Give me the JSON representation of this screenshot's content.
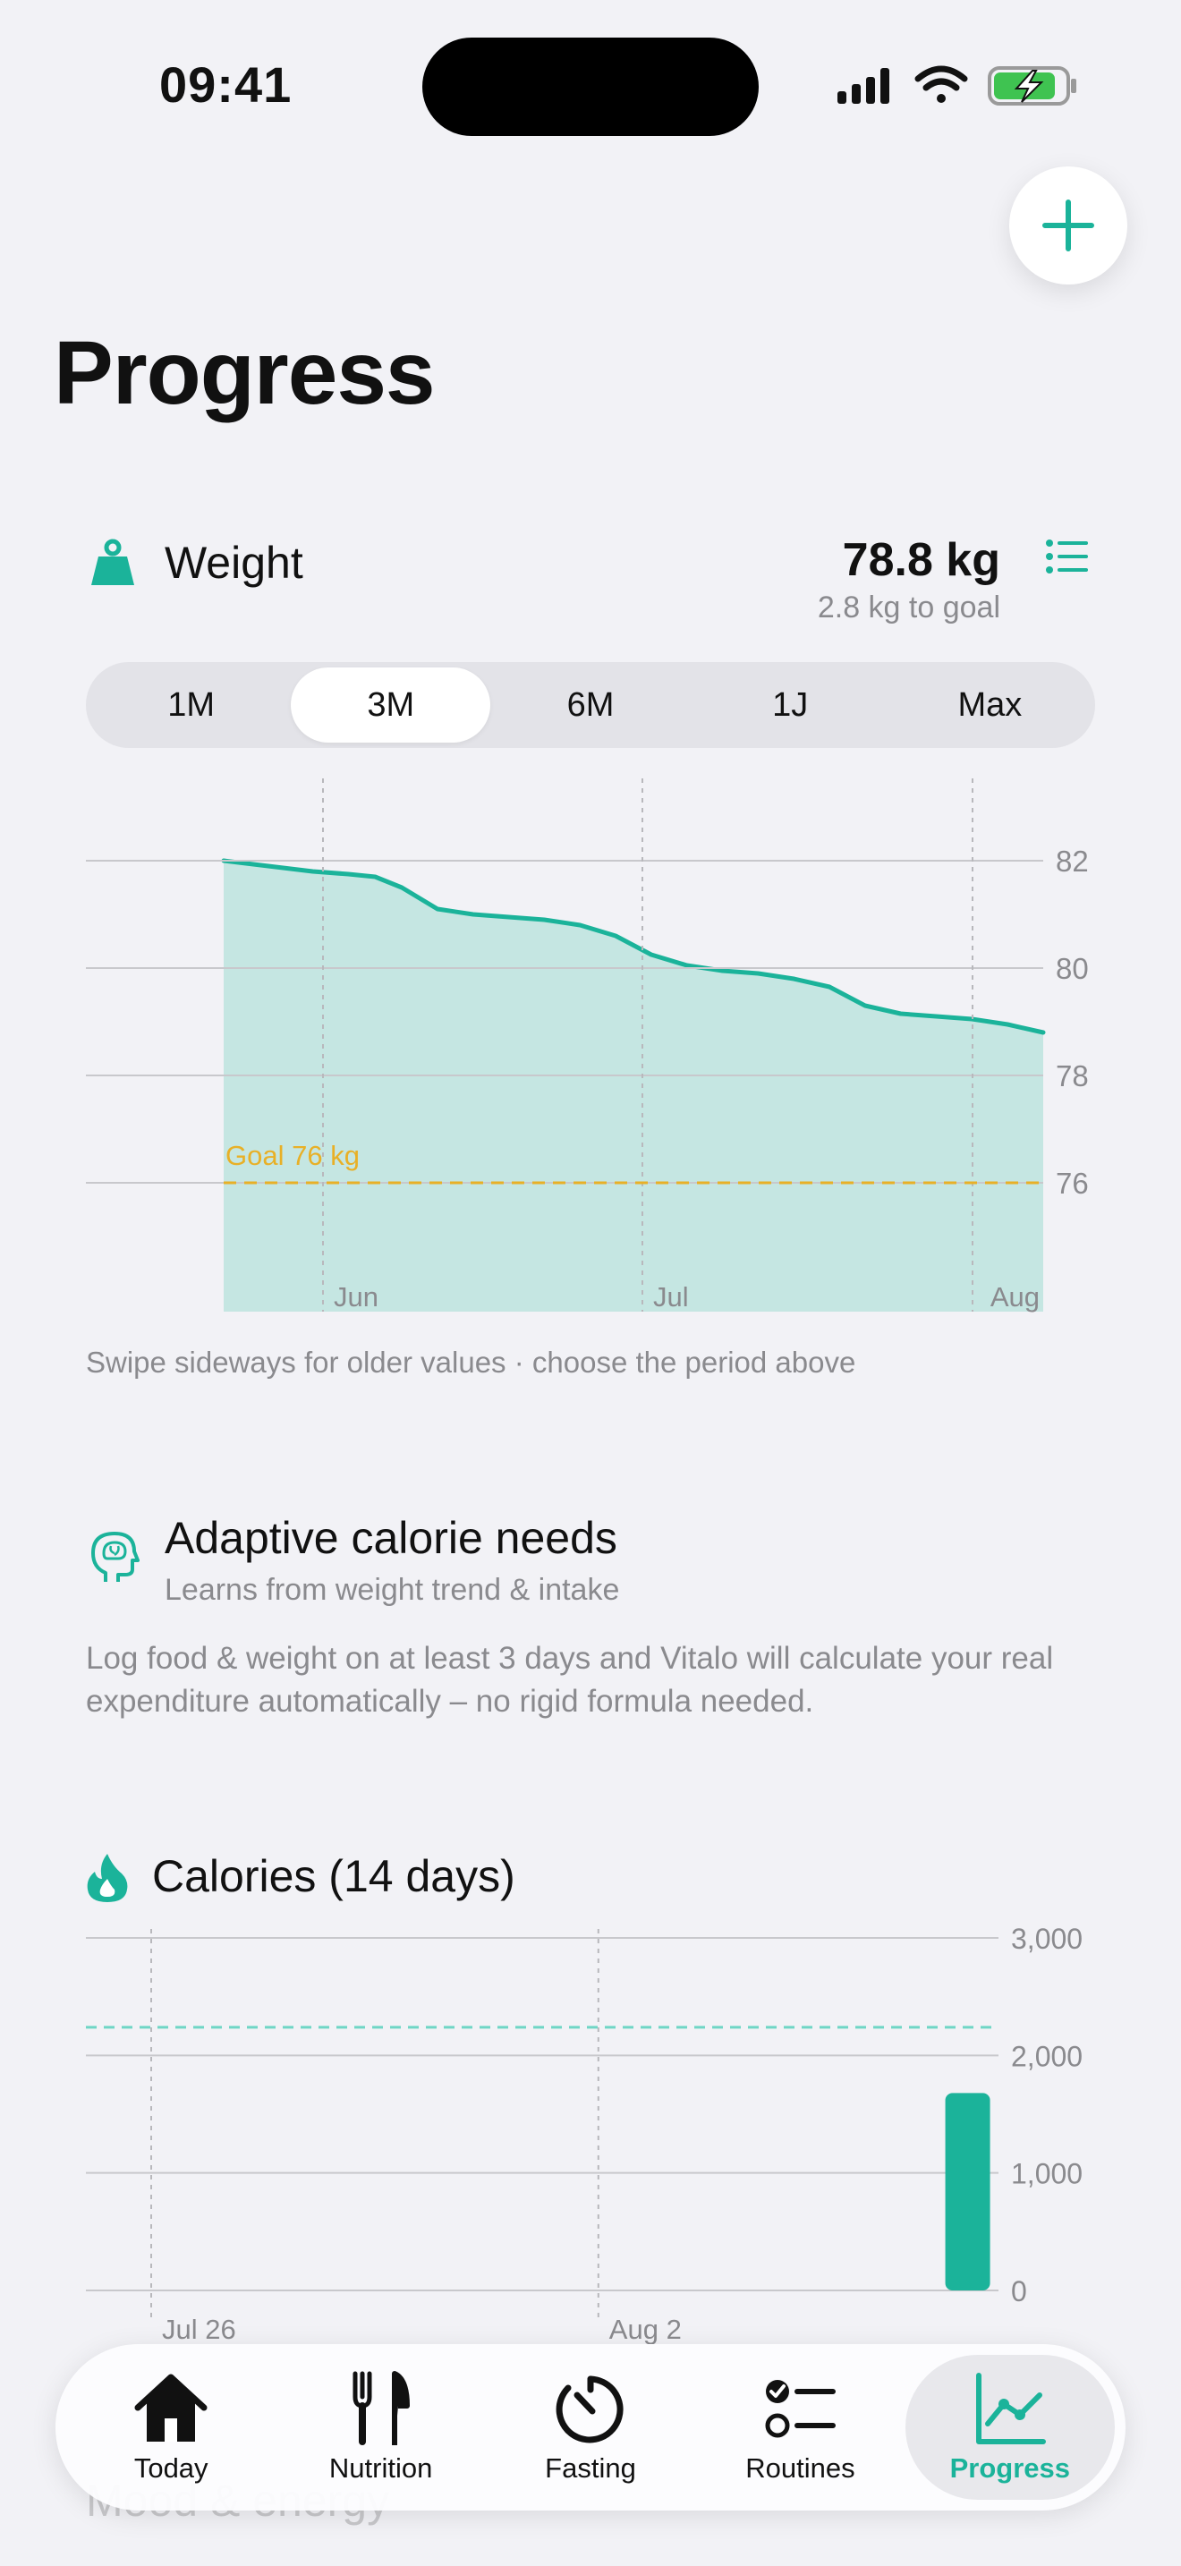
{
  "status": {
    "time": "09:41"
  },
  "page": {
    "title": "Progress"
  },
  "weight": {
    "title": "Weight",
    "value": "78.8 kg",
    "to_goal": "2.8 kg to goal",
    "periods": [
      "1M",
      "3M",
      "6M",
      "1J",
      "Max"
    ],
    "selected_period": "3M",
    "goal_label": "Goal 76 kg",
    "note": "Swipe sideways for older values · choose the period above"
  },
  "adaptive": {
    "title": "Adaptive calorie needs",
    "subtitle": "Learns from weight trend & intake",
    "body": "Log food & weight on at least 3 days and Vitalo will calculate your real expenditure automatically – no rigid formula needed."
  },
  "calories": {
    "title": "Calories (14 days)"
  },
  "chart_data": [
    {
      "type": "area",
      "title": "Weight",
      "x_labels": [
        "Jun",
        "Jul",
        "Aug"
      ],
      "y_ticks": [
        82,
        80,
        78,
        76
      ],
      "ylim": [
        73.6,
        83.2
      ],
      "goal": {
        "value": 76,
        "label": "Goal 76 kg"
      },
      "x": [
        0,
        5,
        10,
        14,
        17,
        20,
        24,
        28,
        32,
        36,
        40,
        44,
        48,
        52,
        56,
        60,
        64,
        68,
        72,
        76,
        80,
        84,
        88,
        92
      ],
      "values": [
        82.0,
        81.9,
        81.8,
        81.75,
        81.7,
        81.5,
        81.1,
        81.0,
        80.95,
        80.9,
        80.8,
        80.6,
        80.25,
        80.05,
        79.95,
        79.9,
        79.8,
        79.65,
        79.3,
        79.15,
        79.1,
        79.05,
        78.95,
        78.8
      ],
      "grid": true,
      "color": "#1bb39a",
      "fill": "#c5e6e2",
      "goal_color": "#e8b027"
    },
    {
      "type": "bar",
      "title": "Calories (14 days)",
      "x_labels": [
        "Jul 26",
        "Aug 2"
      ],
      "y_ticks": [
        3000,
        2000,
        1000,
        0
      ],
      "ylim": [
        0,
        3000
      ],
      "target": 2240,
      "values": [
        0,
        0,
        0,
        0,
        0,
        0,
        0,
        0,
        0,
        0,
        0,
        0,
        0,
        1680
      ],
      "grid": true,
      "color": "#1bb39a"
    }
  ],
  "tabs": [
    {
      "label": "Today",
      "icon": "home-icon"
    },
    {
      "label": "Nutrition",
      "icon": "fork-knife-icon"
    },
    {
      "label": "Fasting",
      "icon": "timer-icon"
    },
    {
      "label": "Routines",
      "icon": "checklist-icon"
    },
    {
      "label": "Progress",
      "icon": "chart-line-icon"
    }
  ],
  "next_section": {
    "title": "Mood & energy"
  },
  "colors": {
    "accent": "#1bb39a",
    "goal": "#e8b027",
    "background": "#f2f2f6"
  }
}
